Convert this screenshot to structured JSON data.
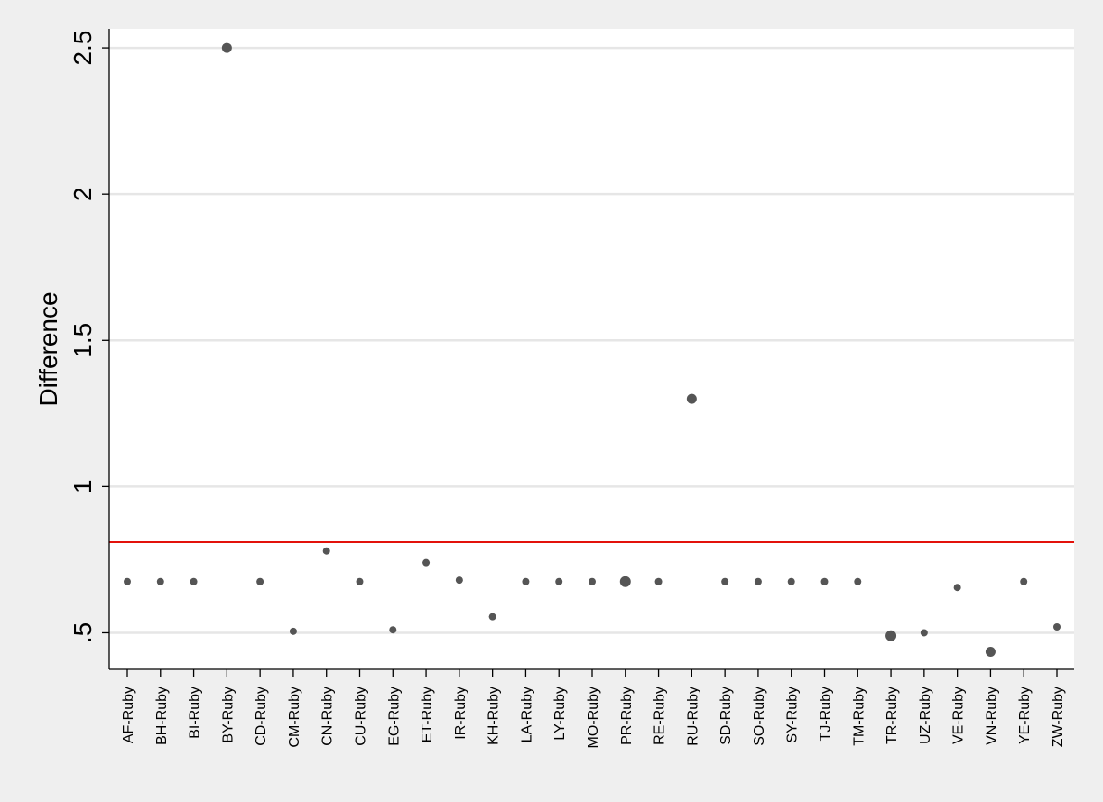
{
  "chart_data": {
    "type": "scatter",
    "title": "",
    "xlabel": "",
    "ylabel": "Difference",
    "ylim": [
      0.375,
      2.565
    ],
    "yticks": [
      0.5,
      1,
      1.5,
      2,
      2.5
    ],
    "yticklabels": [
      ".5",
      "1",
      "1.5",
      "2",
      "2.5"
    ],
    "grid": true,
    "legend": "none",
    "reference_line": {
      "y": 0.81,
      "color": "#e3120b"
    },
    "marker_color": "#555555",
    "categories": [
      "AF-Ruby",
      "BH-Ruby",
      "BI-Ruby",
      "BY-Ruby",
      "CD-Ruby",
      "CM-Ruby",
      "CN-Ruby",
      "CU-Ruby",
      "EG-Ruby",
      "ET-Ruby",
      "IR-Ruby",
      "KH-Ruby",
      "LA-Ruby",
      "LY-Ruby",
      "MO-Ruby",
      "PR-Ruby",
      "RE-Ruby",
      "RU-Ruby",
      "SD-Ruby",
      "SO-Ruby",
      "SY-Ruby",
      "TJ-Ruby",
      "TM-Ruby",
      "TR-Ruby",
      "UZ-Ruby",
      "VE-Ruby",
      "VN-Ruby",
      "YE-Ruby",
      "ZW-Ruby"
    ],
    "values": [
      0.675,
      0.675,
      0.675,
      2.5,
      0.675,
      0.505,
      0.78,
      0.675,
      0.51,
      0.74,
      0.68,
      0.555,
      0.675,
      0.675,
      0.675,
      0.675,
      0.675,
      1.3,
      0.675,
      0.675,
      0.675,
      0.675,
      0.675,
      0.49,
      0.5,
      0.655,
      0.435,
      0.675,
      0.52
    ],
    "marker_weight": [
      1,
      1,
      1,
      2,
      1,
      1,
      1,
      1,
      1,
      1,
      1,
      1,
      1,
      1,
      1,
      3,
      1,
      2,
      1,
      1,
      1,
      1,
      1,
      3,
      1,
      1,
      2,
      1,
      1
    ]
  }
}
